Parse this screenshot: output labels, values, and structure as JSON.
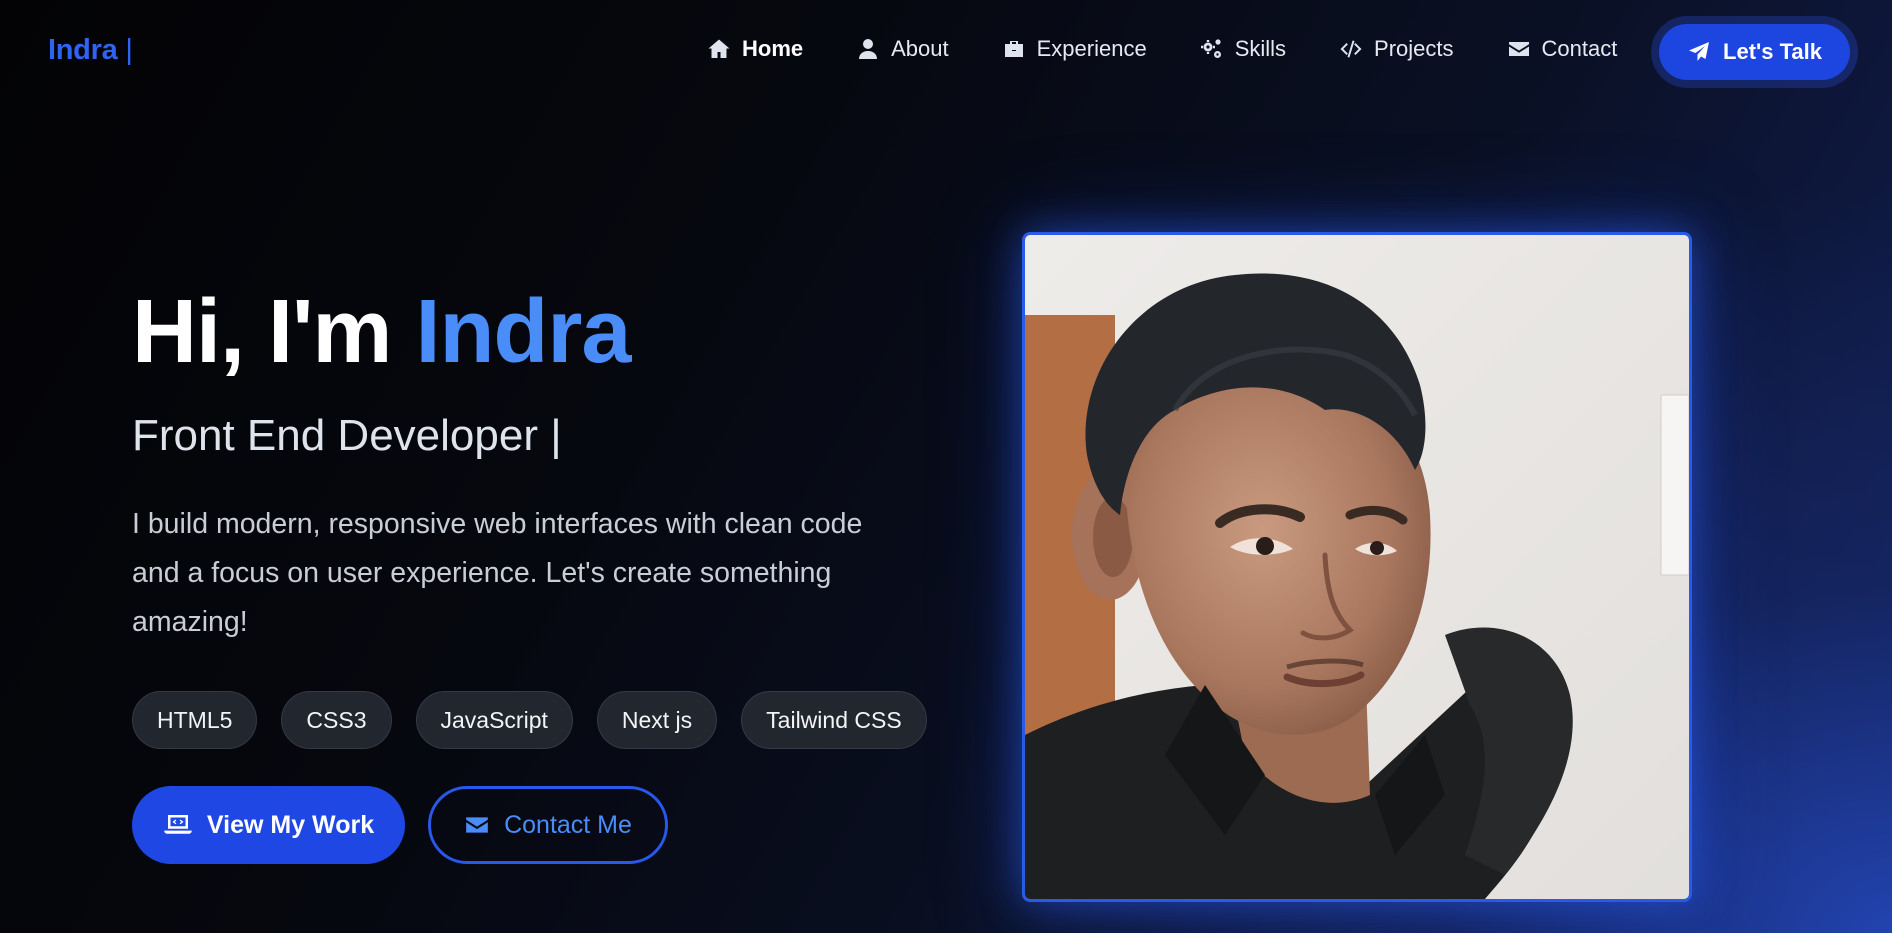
{
  "nav": {
    "logo": "Indra",
    "logo_caret": "|",
    "items": [
      {
        "label": "Home",
        "icon": "home-icon",
        "active": true
      },
      {
        "label": "About",
        "icon": "user-icon",
        "active": false
      },
      {
        "label": "Experience",
        "icon": "briefcase-icon",
        "active": false
      },
      {
        "label": "Skills",
        "icon": "gears-icon",
        "active": false
      },
      {
        "label": "Projects",
        "icon": "code-icon",
        "active": false
      },
      {
        "label": "Contact",
        "icon": "envelope-icon",
        "active": false
      }
    ],
    "cta_label": "Let's Talk",
    "cta_icon": "paper-plane-icon"
  },
  "hero": {
    "greeting": "Hi, I'm ",
    "name": "Indra",
    "role": "Front End Developer |",
    "description": "I build modern, responsive web interfaces with clean code and a focus on user experience. Let's create something amazing!",
    "skills": [
      "HTML5",
      "CSS3",
      "JavaScript",
      "Next js",
      "Tailwind CSS"
    ],
    "primary_button": "View My Work",
    "secondary_button": "Contact Me"
  },
  "colors": {
    "accent": "#1e47e4",
    "name_highlight": "#4a8df8",
    "logo": "#2f63f2"
  }
}
